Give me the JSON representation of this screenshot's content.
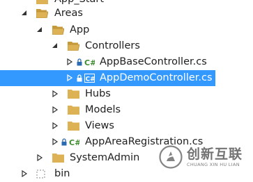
{
  "tree": {
    "items": [
      {
        "label": "App_Start"
      },
      {
        "label": "Areas"
      },
      {
        "label": "App"
      },
      {
        "label": "Controllers"
      },
      {
        "label": "AppBaseController.cs"
      },
      {
        "label": "AppDemoController.cs"
      },
      {
        "label": "Hubs"
      },
      {
        "label": "Models"
      },
      {
        "label": "Views"
      },
      {
        "label": "AppAreaRegistration.cs"
      },
      {
        "label": "SystemAdmin"
      },
      {
        "label": "bin"
      }
    ],
    "selected_label": "AppDemoController.cs"
  },
  "watermark": {
    "title": "创新互联",
    "subtitle": "CHUANG XIN HU LIAN"
  },
  "colors": {
    "selection": "#3399ff",
    "folder": "#dcb254",
    "csharp_badge": "#3d8b2f",
    "lock": "#2b6bb3"
  }
}
